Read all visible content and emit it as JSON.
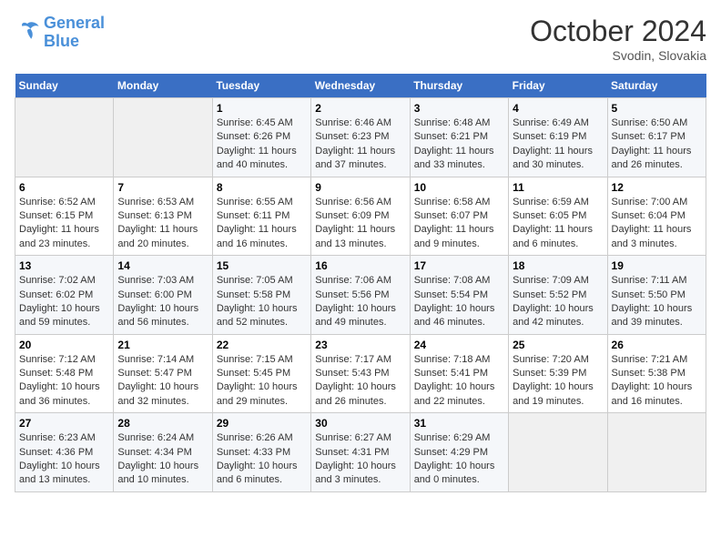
{
  "header": {
    "logo_line1": "General",
    "logo_line2": "Blue",
    "month": "October 2024",
    "location": "Svodin, Slovakia"
  },
  "weekdays": [
    "Sunday",
    "Monday",
    "Tuesday",
    "Wednesday",
    "Thursday",
    "Friday",
    "Saturday"
  ],
  "weeks": [
    [
      {
        "day": "",
        "sunrise": "",
        "sunset": "",
        "daylight": ""
      },
      {
        "day": "",
        "sunrise": "",
        "sunset": "",
        "daylight": ""
      },
      {
        "day": "1",
        "sunrise": "Sunrise: 6:45 AM",
        "sunset": "Sunset: 6:26 PM",
        "daylight": "Daylight: 11 hours and 40 minutes."
      },
      {
        "day": "2",
        "sunrise": "Sunrise: 6:46 AM",
        "sunset": "Sunset: 6:23 PM",
        "daylight": "Daylight: 11 hours and 37 minutes."
      },
      {
        "day": "3",
        "sunrise": "Sunrise: 6:48 AM",
        "sunset": "Sunset: 6:21 PM",
        "daylight": "Daylight: 11 hours and 33 minutes."
      },
      {
        "day": "4",
        "sunrise": "Sunrise: 6:49 AM",
        "sunset": "Sunset: 6:19 PM",
        "daylight": "Daylight: 11 hours and 30 minutes."
      },
      {
        "day": "5",
        "sunrise": "Sunrise: 6:50 AM",
        "sunset": "Sunset: 6:17 PM",
        "daylight": "Daylight: 11 hours and 26 minutes."
      }
    ],
    [
      {
        "day": "6",
        "sunrise": "Sunrise: 6:52 AM",
        "sunset": "Sunset: 6:15 PM",
        "daylight": "Daylight: 11 hours and 23 minutes."
      },
      {
        "day": "7",
        "sunrise": "Sunrise: 6:53 AM",
        "sunset": "Sunset: 6:13 PM",
        "daylight": "Daylight: 11 hours and 20 minutes."
      },
      {
        "day": "8",
        "sunrise": "Sunrise: 6:55 AM",
        "sunset": "Sunset: 6:11 PM",
        "daylight": "Daylight: 11 hours and 16 minutes."
      },
      {
        "day": "9",
        "sunrise": "Sunrise: 6:56 AM",
        "sunset": "Sunset: 6:09 PM",
        "daylight": "Daylight: 11 hours and 13 minutes."
      },
      {
        "day": "10",
        "sunrise": "Sunrise: 6:58 AM",
        "sunset": "Sunset: 6:07 PM",
        "daylight": "Daylight: 11 hours and 9 minutes."
      },
      {
        "day": "11",
        "sunrise": "Sunrise: 6:59 AM",
        "sunset": "Sunset: 6:05 PM",
        "daylight": "Daylight: 11 hours and 6 minutes."
      },
      {
        "day": "12",
        "sunrise": "Sunrise: 7:00 AM",
        "sunset": "Sunset: 6:04 PM",
        "daylight": "Daylight: 11 hours and 3 minutes."
      }
    ],
    [
      {
        "day": "13",
        "sunrise": "Sunrise: 7:02 AM",
        "sunset": "Sunset: 6:02 PM",
        "daylight": "Daylight: 10 hours and 59 minutes."
      },
      {
        "day": "14",
        "sunrise": "Sunrise: 7:03 AM",
        "sunset": "Sunset: 6:00 PM",
        "daylight": "Daylight: 10 hours and 56 minutes."
      },
      {
        "day": "15",
        "sunrise": "Sunrise: 7:05 AM",
        "sunset": "Sunset: 5:58 PM",
        "daylight": "Daylight: 10 hours and 52 minutes."
      },
      {
        "day": "16",
        "sunrise": "Sunrise: 7:06 AM",
        "sunset": "Sunset: 5:56 PM",
        "daylight": "Daylight: 10 hours and 49 minutes."
      },
      {
        "day": "17",
        "sunrise": "Sunrise: 7:08 AM",
        "sunset": "Sunset: 5:54 PM",
        "daylight": "Daylight: 10 hours and 46 minutes."
      },
      {
        "day": "18",
        "sunrise": "Sunrise: 7:09 AM",
        "sunset": "Sunset: 5:52 PM",
        "daylight": "Daylight: 10 hours and 42 minutes."
      },
      {
        "day": "19",
        "sunrise": "Sunrise: 7:11 AM",
        "sunset": "Sunset: 5:50 PM",
        "daylight": "Daylight: 10 hours and 39 minutes."
      }
    ],
    [
      {
        "day": "20",
        "sunrise": "Sunrise: 7:12 AM",
        "sunset": "Sunset: 5:48 PM",
        "daylight": "Daylight: 10 hours and 36 minutes."
      },
      {
        "day": "21",
        "sunrise": "Sunrise: 7:14 AM",
        "sunset": "Sunset: 5:47 PM",
        "daylight": "Daylight: 10 hours and 32 minutes."
      },
      {
        "day": "22",
        "sunrise": "Sunrise: 7:15 AM",
        "sunset": "Sunset: 5:45 PM",
        "daylight": "Daylight: 10 hours and 29 minutes."
      },
      {
        "day": "23",
        "sunrise": "Sunrise: 7:17 AM",
        "sunset": "Sunset: 5:43 PM",
        "daylight": "Daylight: 10 hours and 26 minutes."
      },
      {
        "day": "24",
        "sunrise": "Sunrise: 7:18 AM",
        "sunset": "Sunset: 5:41 PM",
        "daylight": "Daylight: 10 hours and 22 minutes."
      },
      {
        "day": "25",
        "sunrise": "Sunrise: 7:20 AM",
        "sunset": "Sunset: 5:39 PM",
        "daylight": "Daylight: 10 hours and 19 minutes."
      },
      {
        "day": "26",
        "sunrise": "Sunrise: 7:21 AM",
        "sunset": "Sunset: 5:38 PM",
        "daylight": "Daylight: 10 hours and 16 minutes."
      }
    ],
    [
      {
        "day": "27",
        "sunrise": "Sunrise: 6:23 AM",
        "sunset": "Sunset: 4:36 PM",
        "daylight": "Daylight: 10 hours and 13 minutes."
      },
      {
        "day": "28",
        "sunrise": "Sunrise: 6:24 AM",
        "sunset": "Sunset: 4:34 PM",
        "daylight": "Daylight: 10 hours and 10 minutes."
      },
      {
        "day": "29",
        "sunrise": "Sunrise: 6:26 AM",
        "sunset": "Sunset: 4:33 PM",
        "daylight": "Daylight: 10 hours and 6 minutes."
      },
      {
        "day": "30",
        "sunrise": "Sunrise: 6:27 AM",
        "sunset": "Sunset: 4:31 PM",
        "daylight": "Daylight: 10 hours and 3 minutes."
      },
      {
        "day": "31",
        "sunrise": "Sunrise: 6:29 AM",
        "sunset": "Sunset: 4:29 PM",
        "daylight": "Daylight: 10 hours and 0 minutes."
      },
      {
        "day": "",
        "sunrise": "",
        "sunset": "",
        "daylight": ""
      },
      {
        "day": "",
        "sunrise": "",
        "sunset": "",
        "daylight": ""
      }
    ]
  ]
}
